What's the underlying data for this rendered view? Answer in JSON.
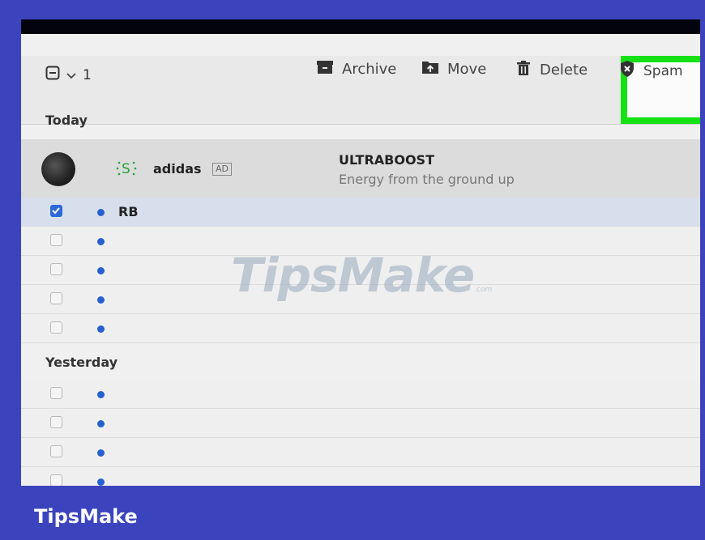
{
  "toolbar": {
    "selected_count": "1",
    "archive_label": "Archive",
    "move_label": "Move",
    "delete_label": "Delete",
    "spam_label": "Spam"
  },
  "sections": {
    "today": "Today",
    "yesterday": "Yesterday"
  },
  "ad": {
    "sender": "adidas",
    "badge": "AD",
    "subject": "ULTRABOOST",
    "preview": "Energy from the ground up"
  },
  "messages": [
    {
      "sender": "RB",
      "checked": true,
      "unread": true
    },
    {
      "sender": "",
      "checked": false,
      "unread": true
    },
    {
      "sender": "",
      "checked": false,
      "unread": true
    },
    {
      "sender": "",
      "checked": false,
      "unread": true
    },
    {
      "sender": "",
      "checked": false,
      "unread": true
    }
  ],
  "yesterday_messages": [
    {
      "sender": "",
      "checked": false,
      "unread": true
    },
    {
      "sender": "",
      "checked": false,
      "unread": true
    },
    {
      "sender": "",
      "checked": false,
      "unread": true
    },
    {
      "sender": "",
      "checked": false,
      "unread": true
    }
  ],
  "watermark": {
    "text": "TipsMake",
    "suffix": ".com"
  },
  "footer": {
    "brand": "TipsMake"
  },
  "colors": {
    "frame_bg": "#3b44bd",
    "highlight": "#14e214",
    "accent": "#2c69d6"
  },
  "icons": [
    "checkbox-select-icon",
    "chevron-down-icon",
    "archive-icon",
    "move-icon",
    "trash-icon",
    "shield-x-icon",
    "avatar",
    "ad-logo-icon",
    "check-icon"
  ]
}
